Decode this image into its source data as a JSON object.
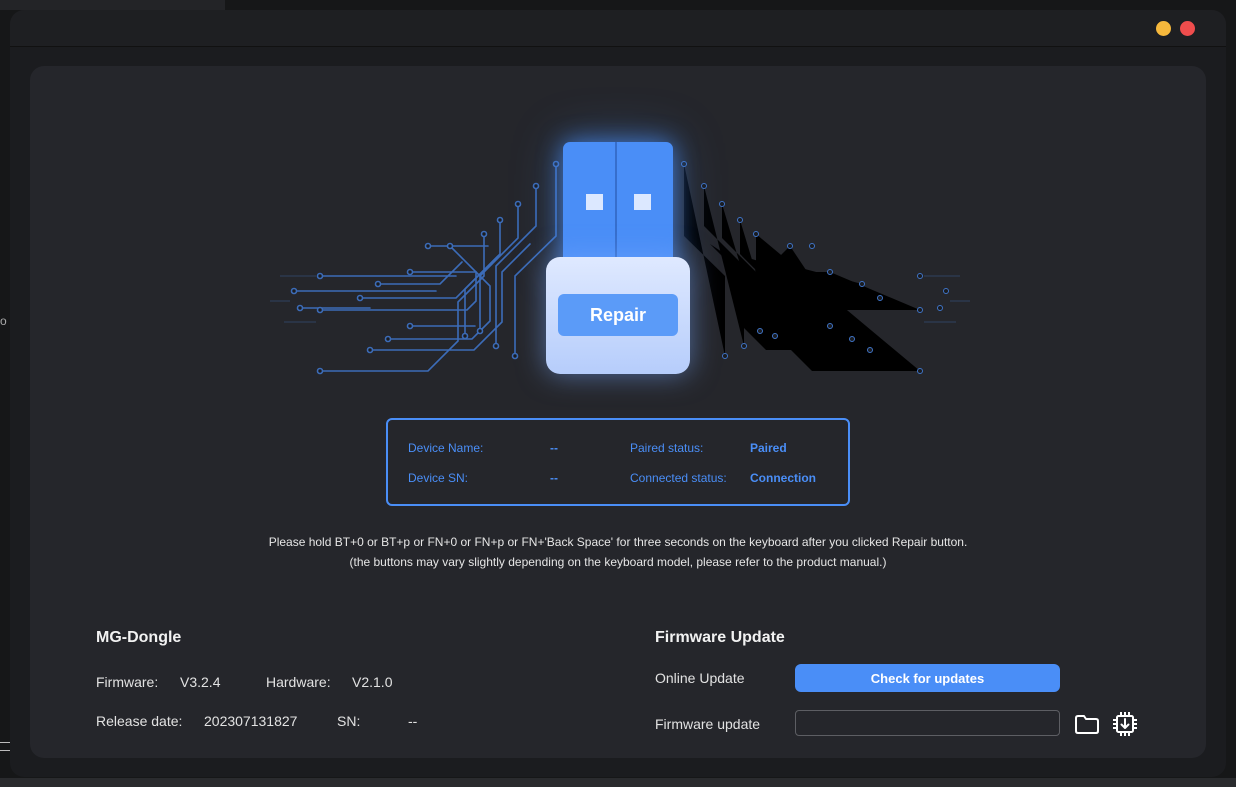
{
  "background": {
    "left_fragment_text": "o"
  },
  "window": {
    "controls": [
      "minimize",
      "close"
    ],
    "colors": {
      "minimize": "#f6b83c",
      "close": "#ef4d4d",
      "accent": "#4a8ef7"
    }
  },
  "hero": {
    "repair_label": "Repair"
  },
  "device_info": {
    "name_label": "Device Name:",
    "name_value": "--",
    "sn_label": "Device SN:",
    "sn_value": "--",
    "paired_label": "Paired status:",
    "paired_value": "Paired",
    "connected_label": "Connected status:",
    "connected_value": "Connection"
  },
  "instructions": {
    "line1": "Please hold BT+0 or BT+p or FN+0 or FN+p or FN+'Back Space' for three seconds on the keyboard after you clicked Repair button.",
    "line2": "(the buttons may vary slightly depending on the keyboard model, please refer to the product manual.)"
  },
  "device": {
    "title": "MG-Dongle",
    "firmware_label": "Firmware:",
    "firmware_value": "V3.2.4",
    "hardware_label": "Hardware:",
    "hardware_value": "V2.1.0",
    "release_label": "Release date:",
    "release_value": "202307131827",
    "sn_label": "SN:",
    "sn_value": "--"
  },
  "firmware_update": {
    "title": "Firmware Update",
    "online_label": "Online Update",
    "check_button": "Check for updates",
    "file_label": "Firmware update",
    "file_value": "",
    "icons": [
      "folder-icon",
      "chip-download-icon"
    ]
  }
}
